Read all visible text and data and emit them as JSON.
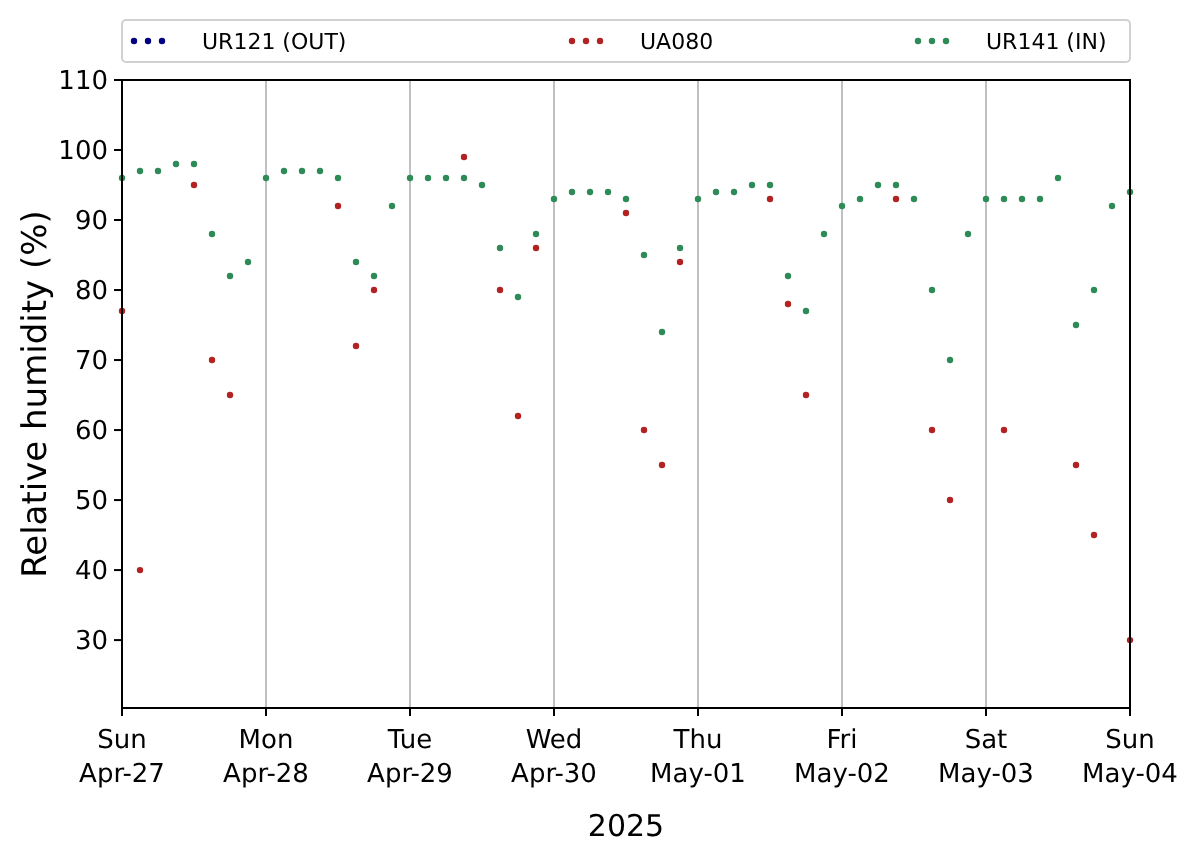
{
  "chart_data": {
    "type": "scatter",
    "grid": "x",
    "legend": "top",
    "ylabel": "Relative humidity (%)",
    "xlabel": "2025",
    "ylim": [
      20.3,
      110
    ],
    "yticks": [
      30,
      40,
      50,
      60,
      70,
      80,
      90,
      100,
      110
    ],
    "categories": [
      "Sun\nApr-27",
      null,
      null,
      null,
      null,
      null,
      null,
      null,
      "Mon\nApr-28",
      null,
      null,
      null,
      null,
      null,
      null,
      null,
      "Tue\nApr-29",
      null,
      null,
      null,
      null,
      null,
      null,
      null,
      "Wed\nApr-30",
      null,
      null,
      null,
      null,
      null,
      null,
      null,
      "Thu\nMay-01",
      null,
      null,
      null,
      null,
      null,
      null,
      null,
      "Fri\nMay-02",
      null,
      null,
      null,
      null,
      null,
      null,
      null,
      "Sat\nMay-03",
      null,
      null,
      null,
      null,
      null,
      null,
      null,
      "Sun\nMay-04"
    ],
    "series": [
      {
        "name": "UR121 (OUT)",
        "color": "#000080",
        "values": [
          null,
          null,
          null,
          null,
          null,
          null,
          null,
          null,
          null,
          null,
          null,
          null,
          null,
          null,
          null,
          null,
          null,
          null,
          null,
          null,
          null,
          null,
          null,
          null,
          null,
          null,
          null,
          null,
          null,
          null,
          null,
          null,
          null,
          null,
          null,
          null,
          null,
          null,
          null,
          null,
          null,
          null,
          null,
          null,
          null,
          null,
          null,
          null,
          null,
          null,
          null,
          null,
          null,
          null,
          null,
          null,
          null
        ]
      },
      {
        "name": "UA080",
        "color": "#b22222",
        "values": [
          77,
          40,
          null,
          null,
          95,
          70,
          65,
          null,
          null,
          null,
          null,
          null,
          92,
          72,
          80,
          null,
          null,
          null,
          null,
          99,
          null,
          80,
          62,
          86,
          null,
          null,
          null,
          null,
          91,
          60,
          55,
          84,
          null,
          null,
          null,
          null,
          93,
          78,
          65,
          null,
          null,
          null,
          null,
          93,
          null,
          60,
          50,
          null,
          null,
          60,
          null,
          null,
          null,
          55,
          45,
          null,
          30
        ]
      },
      {
        "name": "UR141 (IN)",
        "color": "#2e8b57",
        "values": [
          96,
          97,
          97,
          98,
          98,
          88,
          82,
          84,
          96,
          97,
          97,
          97,
          96,
          84,
          82,
          92,
          96,
          96,
          96,
          96,
          95,
          86,
          79,
          88,
          93,
          94,
          94,
          94,
          93,
          85,
          74,
          86,
          93,
          94,
          94,
          95,
          95,
          82,
          77,
          88,
          92,
          93,
          95,
          95,
          93,
          80,
          70,
          88,
          93,
          93,
          93,
          93,
          96,
          75,
          80,
          92,
          94
        ]
      }
    ]
  }
}
